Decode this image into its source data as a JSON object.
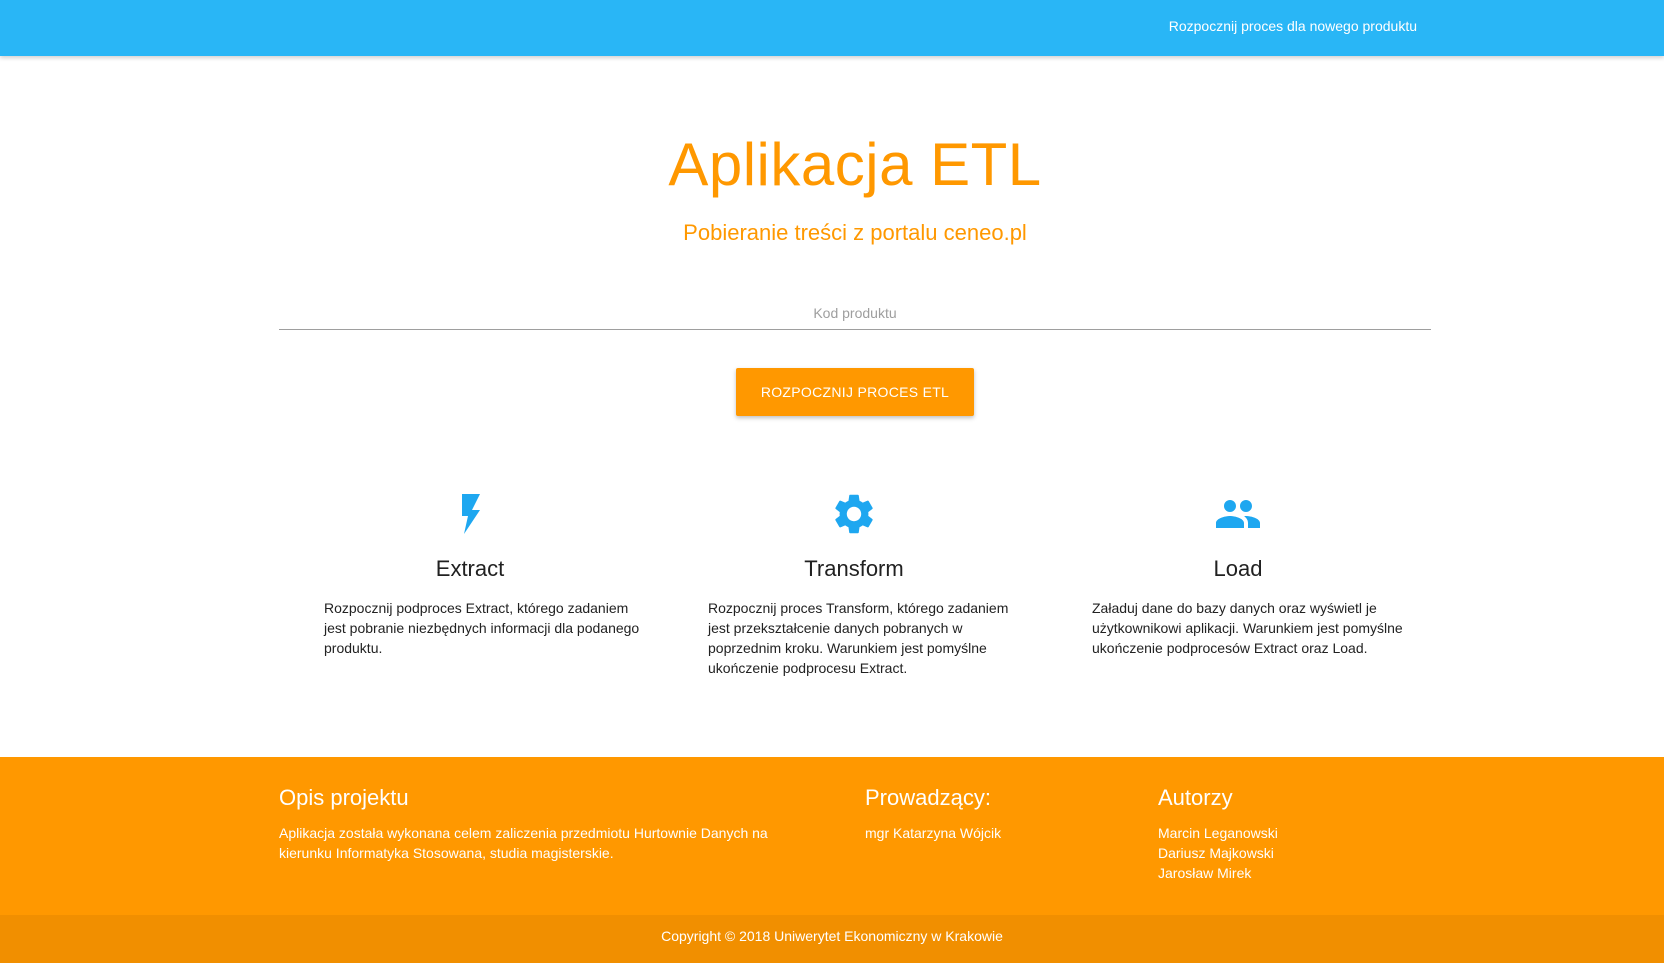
{
  "navbar": {
    "link_label": "Rozpocznij proces dla nowego produktu"
  },
  "hero": {
    "title": "Aplikacja ETL",
    "subtitle": "Pobieranie treści z portalu ceneo.pl"
  },
  "search": {
    "placeholder": "Kod produktu",
    "value": ""
  },
  "action": {
    "button_label": "ROZPOCZNIJ PROCES ETL"
  },
  "features": [
    {
      "icon": "flash-icon",
      "title": "Extract",
      "description": "Rozpocznij podproces Extract, którego zadaniem jest pobranie niezbędnych informacji dla podanego produktu."
    },
    {
      "icon": "gear-icon",
      "title": "Transform",
      "description": "Rozpocznij proces Transform, którego zadaniem jest przekształcenie danych pobranych w poprzednim kroku. Warunkiem jest pomyślne ukończenie podprocesu Extract."
    },
    {
      "icon": "people-icon",
      "title": "Load",
      "description": "Załaduj dane do bazy danych oraz wyświetl je użytkownikowi aplikacji. Warunkiem jest pomyślne ukończenie podprocesów Extract oraz Load."
    }
  ],
  "footer": {
    "project": {
      "heading": "Opis projektu",
      "text": "Aplikacja została wykonana celem zaliczenia przedmiotu Hurtownie Danych na kierunku Informatyka Stosowana, studia magisterskie."
    },
    "supervisor": {
      "heading": "Prowadzący:",
      "name": "mgr Katarzyna Wójcik"
    },
    "authors": {
      "heading": "Autorzy",
      "names": [
        "Marcin Leganowski",
        "Dariusz Majkowski",
        "Jarosław Mirek"
      ]
    },
    "copyright": "Copyright © 2018 Uniwerytet Ekonomiczny w Krakowie"
  },
  "colors": {
    "navbar": "#29b6f6",
    "accent": "#ff9800",
    "icon": "#1ea7f0",
    "footer": "#ff9800",
    "copyright_bar": "#f18f00"
  }
}
